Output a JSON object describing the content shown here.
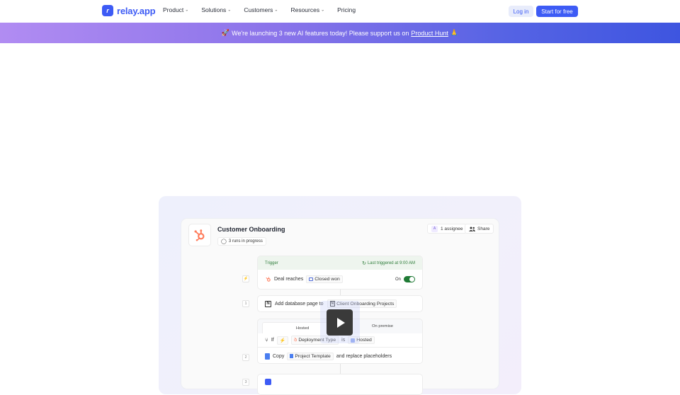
{
  "nav": {
    "brand": "relay.app",
    "brand_mark": "r",
    "links": [
      {
        "label": "Product",
        "has_dropdown": true
      },
      {
        "label": "Solutions",
        "has_dropdown": true
      },
      {
        "label": "Customers",
        "has_dropdown": true
      },
      {
        "label": "Resources",
        "has_dropdown": true
      },
      {
        "label": "Pricing",
        "has_dropdown": false
      }
    ],
    "chevron": "⌄",
    "login_label": "Log in",
    "start_label": "Start for free"
  },
  "banner": {
    "emoji_start": "🚀",
    "text": "We're launching 3 new AI features today! Please support us on",
    "link_text": "Product Hunt",
    "emoji_end": "🙏"
  },
  "workflow": {
    "title": "Customer Onboarding",
    "runs": "3 runs in progress",
    "assignee_initial": "A",
    "assignee_label": "1 assignee",
    "share_label": "Share",
    "trigger": {
      "header": "Trigger",
      "last_triggered": "Last triggered at 9:00 AM",
      "step_symbol": "⚡",
      "text": "Deal reaches",
      "chip": "Closed won",
      "toggle_label": "On",
      "toggle_on": true
    },
    "step1": {
      "number": "1",
      "text": "Add database page to",
      "chip": "Client Onboarding Projects"
    },
    "branch": {
      "tabs": [
        "Hosted",
        "On premise"
      ],
      "active_tab": 0,
      "condition_if": "If",
      "condition_field": "Deployment Type",
      "condition_op": "is",
      "condition_value": "Hosted"
    },
    "step2": {
      "number": "2",
      "prefix": "Copy",
      "chip": "Project Template",
      "suffix": "and replace placeholders"
    },
    "step3": {
      "number": "3"
    }
  },
  "colors": {
    "brand": "#3d5bf5",
    "hubspot": "#ff7a59",
    "toggle_on": "#1f7a35"
  }
}
